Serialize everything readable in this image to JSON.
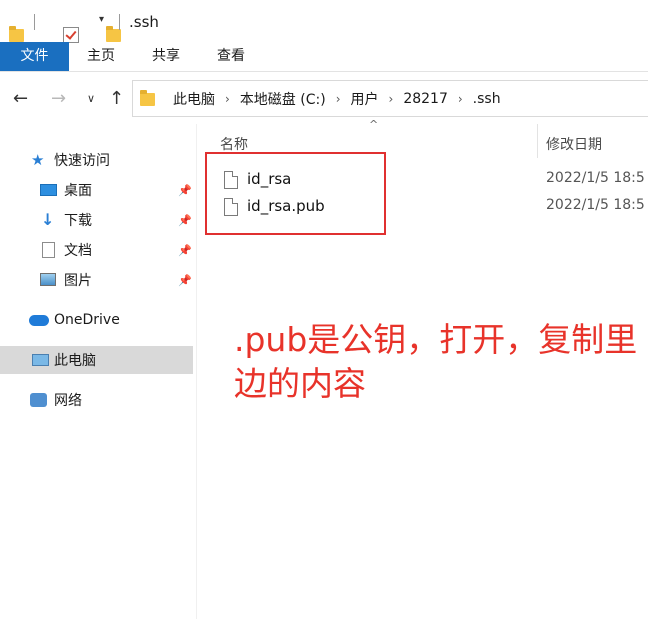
{
  "window": {
    "title": ".ssh"
  },
  "ribbon": {
    "tabs": [
      {
        "label": "文件"
      },
      {
        "label": "主页"
      },
      {
        "label": "共享"
      },
      {
        "label": "查看"
      }
    ]
  },
  "address": {
    "crumbs": [
      "此电脑",
      "本地磁盘 (C:)",
      "用户",
      "28217",
      ".ssh"
    ]
  },
  "nav": {
    "quick_access": "快速访问",
    "items": [
      {
        "label": "桌面"
      },
      {
        "label": "下载"
      },
      {
        "label": "文档"
      },
      {
        "label": "图片"
      }
    ],
    "onedrive": "OneDrive",
    "this_pc": "此电脑",
    "network": "网络"
  },
  "columns": {
    "name": "名称",
    "modified": "修改日期"
  },
  "files": [
    {
      "name": "id_rsa",
      "date": "2022/1/5 18:5"
    },
    {
      "name": "id_rsa.pub",
      "date": "2022/1/5 18:5"
    }
  ],
  "annotation": {
    "text": ".pub是公钥，打开，复制里边的内容"
  },
  "colors": {
    "accent": "#1a6fc0",
    "annotation": "#e8332a",
    "selected": "#d9d9d9"
  }
}
